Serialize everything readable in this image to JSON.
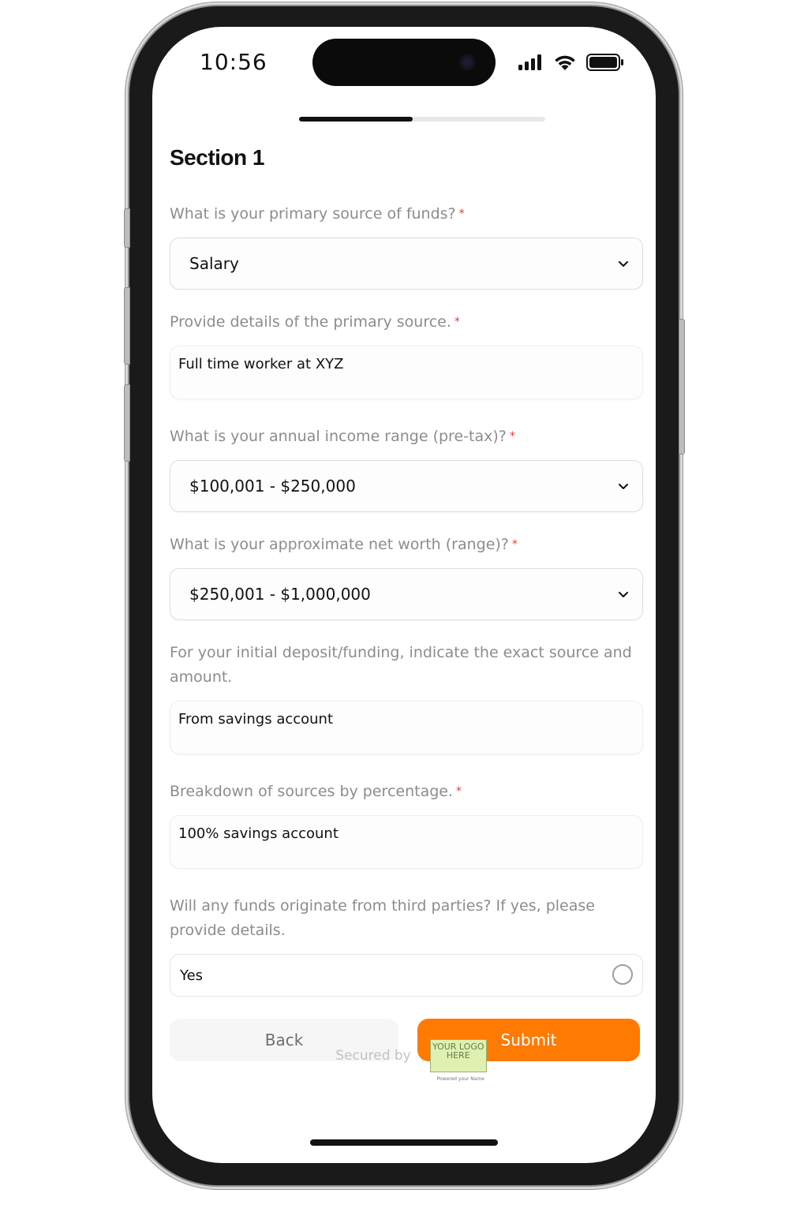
{
  "status_bar": {
    "time": "10:56"
  },
  "progress": {
    "fraction": 0.46
  },
  "form": {
    "section_title": "Section 1",
    "questions": [
      {
        "label": "What is your primary source of funds?",
        "required": "*",
        "type": "select",
        "value": "Salary"
      },
      {
        "label": "Provide details of the primary source.",
        "required": "*",
        "type": "text",
        "value": "Full time worker at XYZ"
      },
      {
        "label": "What is your annual income range (pre-tax)?",
        "required": "*",
        "type": "select",
        "value": "$100,001 - $250,000"
      },
      {
        "label": "What is your approximate net worth (range)?",
        "required": "*",
        "type": "select",
        "value": "$250,001 - $1,000,000"
      },
      {
        "label": "For your initial deposit/funding, indicate the exact source and amount.",
        "required": "",
        "type": "text",
        "value": "From savings account"
      },
      {
        "label": "Breakdown of sources by percentage.",
        "required": "*",
        "type": "text",
        "value": "100% savings account"
      },
      {
        "label": "Will any funds originate from third parties? If yes, please provide details.",
        "required": "",
        "type": "radio",
        "value": "Yes"
      }
    ]
  },
  "buttons": {
    "back_label": "Back",
    "submit_label": "Submit"
  },
  "footer": {
    "secured_label": "Secured by",
    "logo_text": "YOUR LOGO HERE",
    "logo_tagline": "Powered your Name"
  },
  "colors": {
    "accent": "#ff7a00",
    "required": "#e53935",
    "label": "#8c8c8c"
  },
  "icons": {
    "chevron": "chevron-down-icon",
    "signal": "cellular-signal-icon",
    "wifi": "wifi-icon",
    "battery": "battery-icon"
  }
}
